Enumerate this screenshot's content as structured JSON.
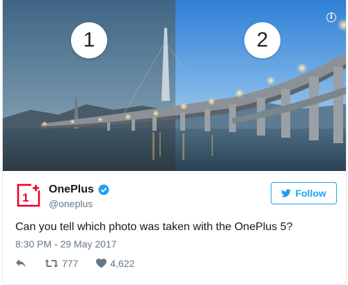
{
  "media": {
    "photo_labels": [
      "1",
      "2"
    ],
    "info_icon": "info-icon"
  },
  "author": {
    "name": "OnePlus",
    "handle": "@oneplus",
    "verified": true,
    "avatar_icon": "oneplus-logo",
    "brand_color": "#eb0028"
  },
  "follow": {
    "label": "Follow",
    "icon": "twitter-bird-icon",
    "accent": "#1da1f2"
  },
  "tweet": {
    "text": "Can you tell which photo was taken with the OnePlus 5?",
    "timestamp": "8:30 PM - 29 May 2017"
  },
  "actions": {
    "reply_icon": "reply-icon",
    "retweet_icon": "retweet-icon",
    "retweet_count": "777",
    "like_icon": "heart-icon",
    "like_count": "4,622"
  }
}
